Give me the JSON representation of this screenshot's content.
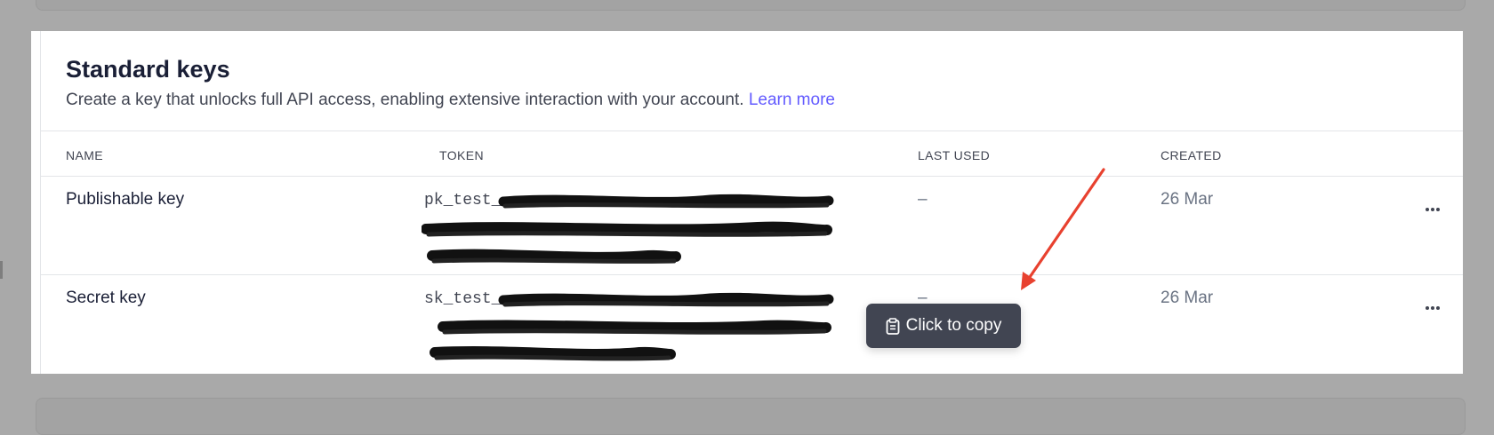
{
  "section": {
    "title": "Standard keys",
    "description": "Create a key that unlocks full API access, enabling extensive interaction with your account.",
    "learn_more": "Learn more"
  },
  "table": {
    "headers": [
      "NAME",
      "TOKEN",
      "LAST USED",
      "CREATED"
    ],
    "rows": [
      {
        "name": "Publishable key",
        "token_prefix": "pk_test_",
        "last_used": "–",
        "created": "26 Mar"
      },
      {
        "name": "Secret key",
        "token_prefix": "sk_test_",
        "last_used": "–",
        "created": "26 Mar"
      }
    ]
  },
  "tooltip": {
    "label": "Click to copy",
    "icon": "clipboard-icon"
  },
  "annotation": {
    "icon": "red-arrow-icon",
    "color": "#e8412f"
  },
  "colors": {
    "link": "#635bff",
    "tooltip_bg": "#414552"
  }
}
